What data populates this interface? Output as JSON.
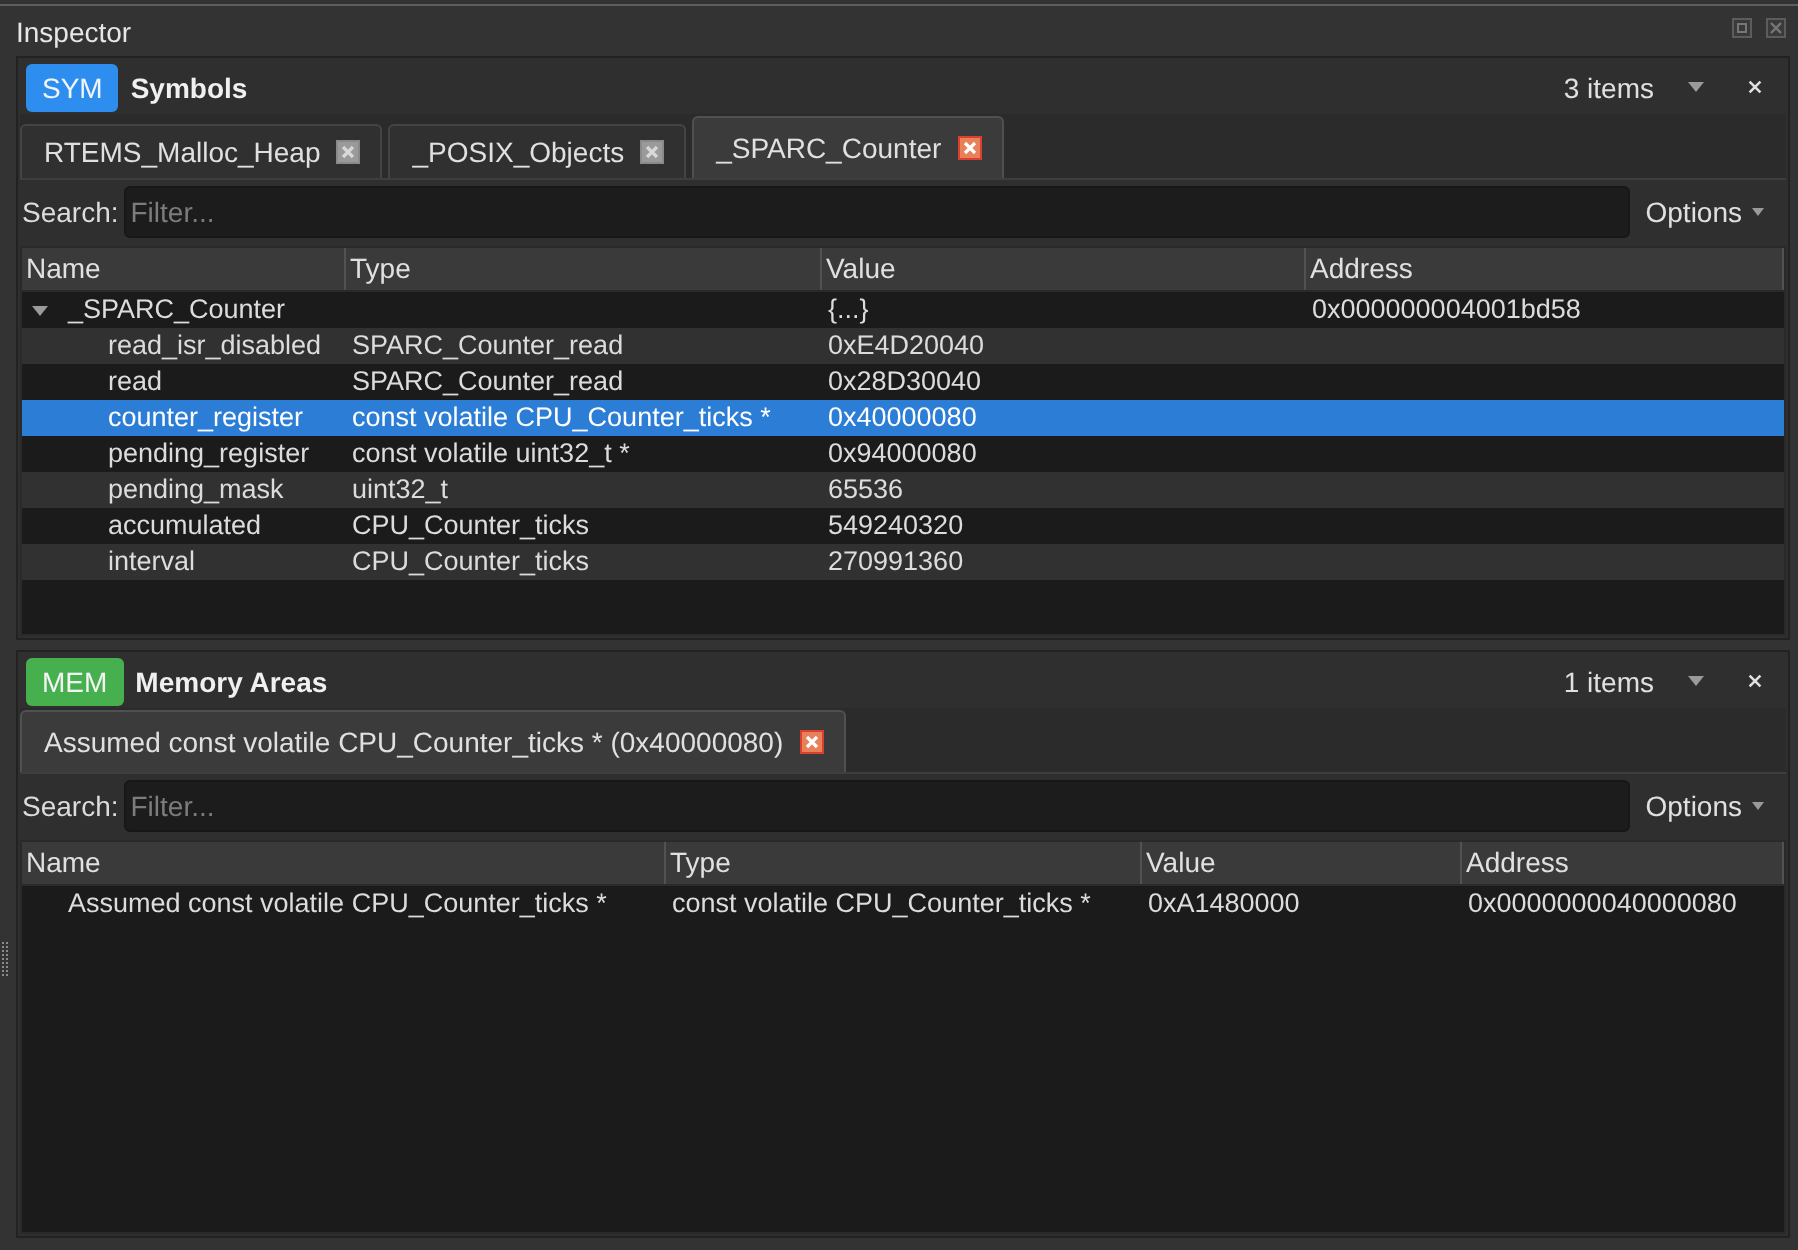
{
  "window": {
    "title": "Inspector"
  },
  "panels": [
    {
      "badge": "SYM",
      "color": "#2d8ef0",
      "title": "Symbols",
      "count": "3 items",
      "tabs": [
        {
          "label": "RTEMS_Malloc_Heap",
          "selected": false
        },
        {
          "label": "_POSIX_Objects",
          "selected": false
        },
        {
          "label": "_SPARC_Counter",
          "selected": true
        }
      ],
      "search": {
        "label": "Search:",
        "placeholder": "Filter..."
      },
      "options": "Options",
      "table": {
        "columns": [
          "Name",
          "Type",
          "Value",
          "Address"
        ],
        "rows": [
          {
            "name": "_SPARC_Counter",
            "value": "{...}",
            "address": "0x000000004001bd58",
            "expanded": true,
            "selected": false,
            "children": [
              {
                "name": "read_isr_disabled",
                "type": "SPARC_Counter_read",
                "value": "0xE4D20040",
                "selected": false
              },
              {
                "name": "read",
                "type": "SPARC_Counter_read",
                "value": "0x28D30040",
                "selected": false
              },
              {
                "name": "counter_register",
                "type": "const volatile CPU_Counter_ticks *",
                "value": "0x40000080",
                "selected": true
              },
              {
                "name": "pending_register",
                "type": "const volatile uint32_t *",
                "value": "0x94000080",
                "selected": false
              },
              {
                "name": "pending_mask",
                "type": "uint32_t",
                "value": "65536",
                "selected": false
              },
              {
                "name": "accumulated",
                "type": "CPU_Counter_ticks",
                "value": "549240320",
                "selected": false
              },
              {
                "name": "interval",
                "type": "CPU_Counter_ticks",
                "value": "270991360",
                "selected": false
              }
            ]
          }
        ]
      }
    },
    {
      "badge": "MEM",
      "color": "#47b04e",
      "title": "Memory Areas",
      "count": "1 items",
      "tabs": [
        {
          "label": "Assumed const volatile CPU_Counter_ticks * (0x40000080)",
          "selected": true
        }
      ],
      "search": {
        "label": "Search:",
        "placeholder": "Filter..."
      },
      "options": "Options",
      "table": {
        "columns": [
          "Name",
          "Type",
          "Value",
          "Address"
        ],
        "rows": [
          {
            "name": "Assumed const volatile CPU_Counter_ticks *",
            "type": "const volatile CPU_Counter_ticks *",
            "value": "0xA1480000",
            "address": "0x0000000040000080",
            "selected": false
          }
        ]
      }
    }
  ]
}
